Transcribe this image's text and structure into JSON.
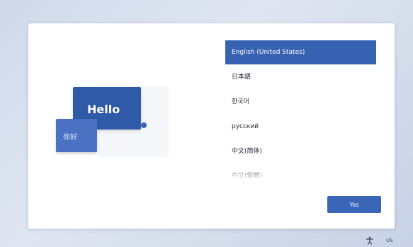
{
  "languages": [
    {
      "label": "English (United States)",
      "selected": true
    },
    {
      "label": "日本語",
      "selected": false
    },
    {
      "label": "한국어",
      "selected": false
    },
    {
      "label": "русский",
      "selected": false
    },
    {
      "label": "中文(简体)",
      "selected": false
    },
    {
      "label": "中文(繁體)",
      "selected": false
    }
  ],
  "illustration": {
    "hello_text": "Hello",
    "nihao_text": "你好"
  },
  "yes_button_label": "Yes",
  "taskbar": {
    "accessibility_icon": "accessibility-icon",
    "language_indicator": "US"
  },
  "colors": {
    "accent": "#3762b2",
    "hello_bubble": "#2f5aa8",
    "nihao_bubble": "#4b72c2"
  }
}
